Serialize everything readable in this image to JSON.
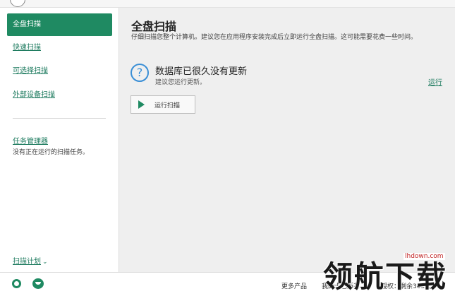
{
  "sidebar": {
    "items": [
      {
        "label": "全盘扫描",
        "active": true
      },
      {
        "label": "快速扫描",
        "active": false
      },
      {
        "label": "可选择扫描",
        "active": false
      },
      {
        "label": "外部设备扫描",
        "active": false
      }
    ],
    "task_manager_label": "任务管理器",
    "task_status": "没有正在运行的扫描任务。",
    "schedule_label": "扫描计划"
  },
  "main": {
    "title": "全盘扫描",
    "description": "仔细扫描您整个计算机。建议您在应用程序安装完成后立即运行全盘扫描。这可能需要花费一些时间。",
    "alert": {
      "title": "数据库已很久没有更新",
      "subtitle": "建议您运行更新。",
      "action": "运行"
    },
    "scan_button_label": "运行扫描"
  },
  "footer": {
    "more_products": "更多产品",
    "my_account": "我的卡巴斯基",
    "license": "授权：剩余365天"
  },
  "watermark": {
    "text": "领航下载",
    "url": "lhdown.com"
  },
  "colors": {
    "accent": "#1f8a62",
    "link": "#1e7b5f",
    "info": "#3a8fd6"
  }
}
